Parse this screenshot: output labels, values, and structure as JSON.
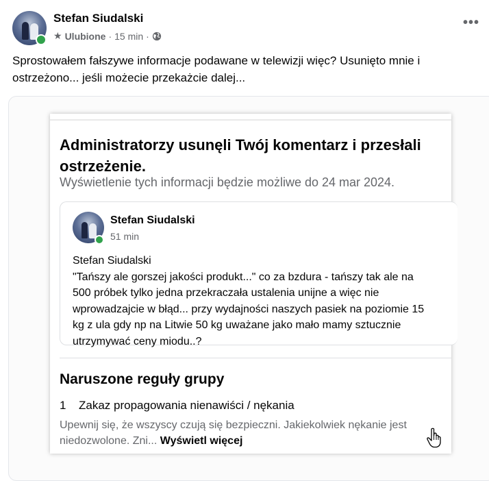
{
  "post": {
    "author": "Stefan Siudalski",
    "favorites_label": "Ulubione",
    "time": "15 min",
    "separator": "·",
    "more_label": "•••",
    "text": "Sprostowałem fałszywe informacje podawane w telewizji więc? Usunięto mnie i ostrzeżono... jeśli możecie przekażcie dalej..."
  },
  "card": {
    "title": "Administratorzy usunęli Twój komentarz i przesłali ostrzeżenie.",
    "subtitle": "Wyświetlenie tych informacji będzie możliwe do 24 mar 2024.",
    "comment": {
      "author": "Stefan Siudalski",
      "time": "51 min",
      "lines": [
        "Stefan Siudalski",
        "\"Tańszy ale gorszej jakości produkt...\" co za bzdura - tańszy tak ale na",
        "500 próbek tylko jedna przekraczała ustalenia unijne a więc nie",
        "wprowadzajcie w błąd... przy wydajności naszych pasiek na poziomie 15",
        "kg z ula gdy np na Litwie 50 kg uważane jako mało mamy sztucznie",
        "utrzymywać ceny miodu..?"
      ]
    },
    "rules_title": "Naruszone reguły grupy",
    "rule": {
      "number": "1",
      "name": "Zakaz propagowania nienawiści / nękania",
      "description": "Upewnij się, że wszyscy czują się bezpieczni. Jakiekolwiek nękanie jest niedozwolone. Zni...",
      "see_more": "Wyświetl więcej"
    }
  },
  "icons": {
    "star": "star-icon",
    "globe": "globe-icon",
    "more": "more-icon",
    "cursor": "hand-cursor-icon"
  },
  "colors": {
    "online": "#31a24c",
    "secondary_text": "#65676b",
    "primary_text": "#050505"
  }
}
